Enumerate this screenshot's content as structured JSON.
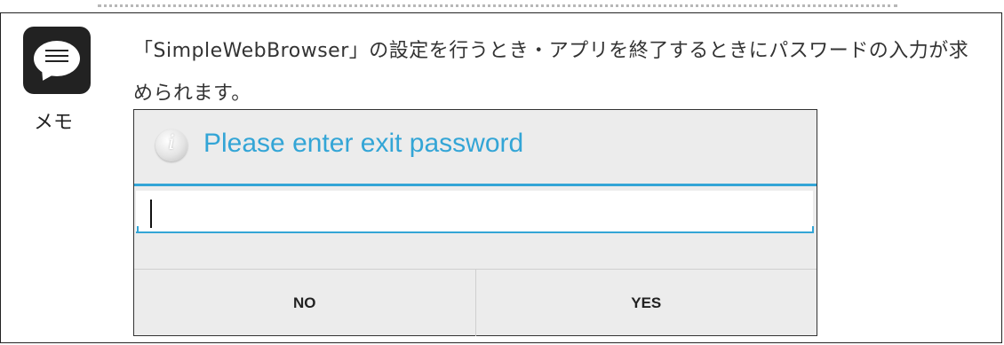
{
  "memo": {
    "icon": "memo-speech-bubble-icon",
    "label": "メモ",
    "text": "「SimpleWebBrowser」の設定を行うとき・アプリを終了するときにパスワードの入力が求められます。"
  },
  "dialog": {
    "icon": "info-icon",
    "title": "Please enter exit password",
    "password_value": "",
    "no_label": "NO",
    "yes_label": "YES",
    "accent_color": "#33a5d6"
  }
}
